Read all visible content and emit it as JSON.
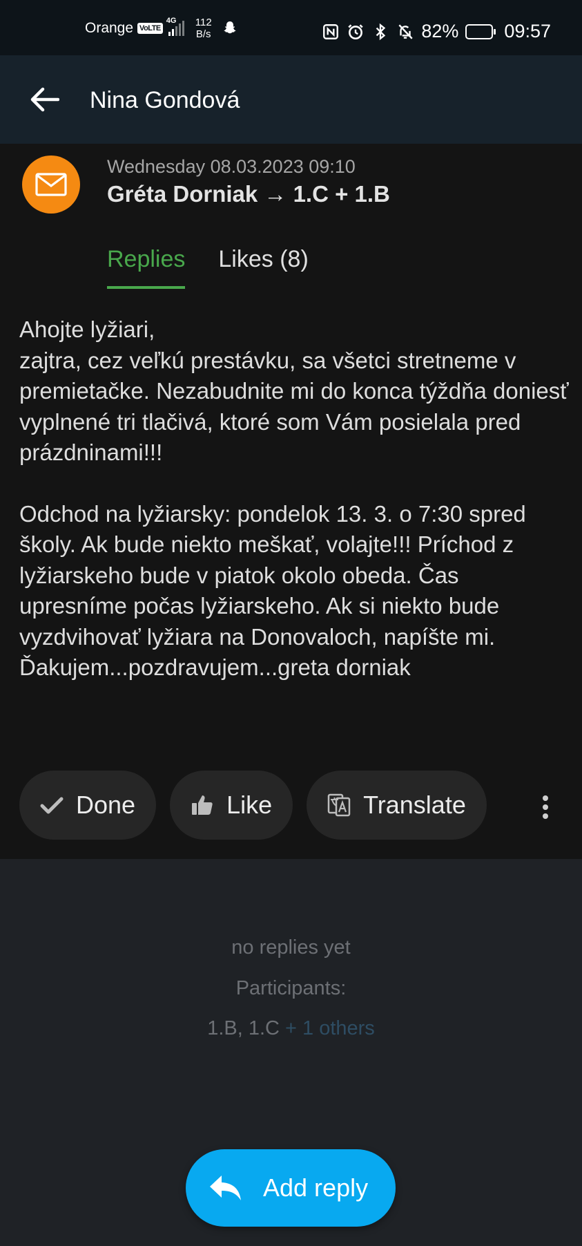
{
  "status_bar": {
    "carrier": "Orange",
    "volte": "VoLTE",
    "network": "4G",
    "speed_value": "112",
    "speed_unit": "B/s",
    "battery": "82%",
    "battery_level": 0.82,
    "time": "09:57"
  },
  "app_bar": {
    "title": "Nina Gondová"
  },
  "message": {
    "date": "Wednesday 08.03.2023 09:10",
    "route": "Gréta Dorniak → 1.C + 1.B",
    "avatar_color": "#f58a12",
    "tabs": [
      {
        "label": "Replies",
        "active": true
      },
      {
        "label": "Likes (8)",
        "active": false
      }
    ],
    "paragraph_1": "Ahojte lyžiari,\nzajtra, cez veľkú prestávku, sa všetci stretneme v premietačke. Nezabudnite mi do konca týždňa doniesť vyplnené tri tlačivá, ktoré som Vám posielala pred prázdninami!!!",
    "paragraph_2": "Odchod na lyžiarsky: pondelok 13. 3. o 7:30 spred školy. Ak bude niekto meškať, volajte!!! Príchod z lyžiarskeho bude v piatok okolo obeda. Čas upresníme počas lyžiarskeho. Ak si niekto bude vyzdvihovať lyžiara na Donovaloch, napíšte mi. Ďakujem...pozdravujem...greta dorniak"
  },
  "actions": {
    "done_label": "Done",
    "like_label": "Like",
    "translate_label": "Translate"
  },
  "replies": {
    "empty_text": "no replies yet",
    "participants_label": "Participants:",
    "participants": "1.B, 1.C",
    "others_link": "+ 1 others"
  },
  "fab": {
    "label": "Add reply",
    "color": "#08a9f0"
  }
}
